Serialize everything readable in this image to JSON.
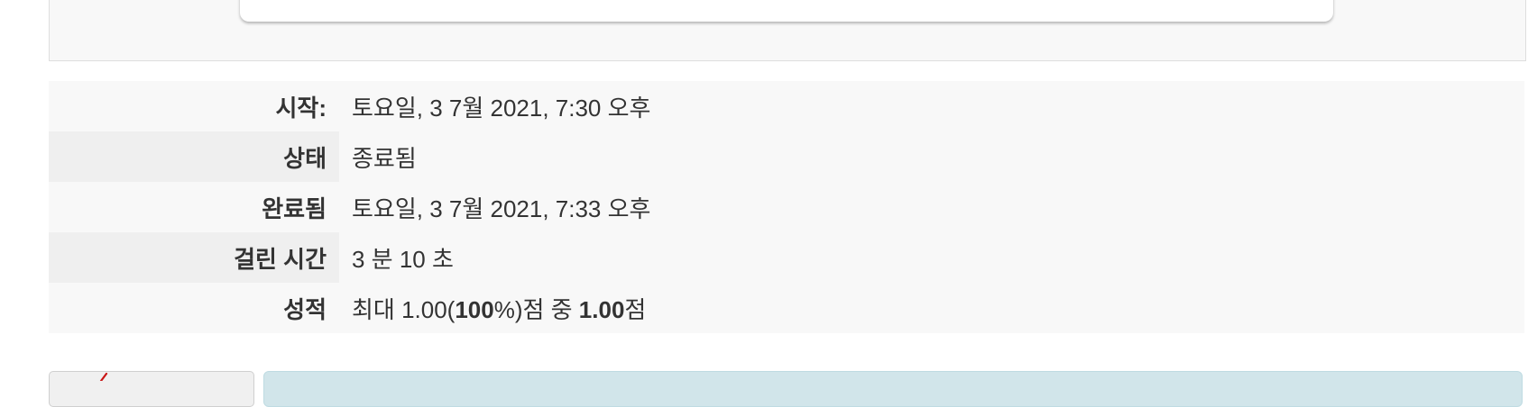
{
  "summary": {
    "rows": [
      {
        "label": "시작:",
        "value": "토요일, 3 7월 2021, 7:30 오후"
      },
      {
        "label": "상태",
        "value": "종료됨"
      },
      {
        "label": "완료됨",
        "value": "토요일, 3 7월 2021, 7:33 오후"
      },
      {
        "label": "걸린 시간",
        "value": "3 분 10 초"
      }
    ],
    "grade": {
      "label": "성적",
      "prefix": "최대 1.00(",
      "percent": "100",
      "middle": "%)점 중 ",
      "score": "1.00",
      "suffix": "점"
    }
  },
  "question_info": {
    "flag_icon": "flag-icon"
  },
  "colors": {
    "panel_bg": "#f8f8f8",
    "label_bg_alt": "#efefef",
    "content_bg": "#d1e5ea",
    "flag": "#c91616"
  }
}
